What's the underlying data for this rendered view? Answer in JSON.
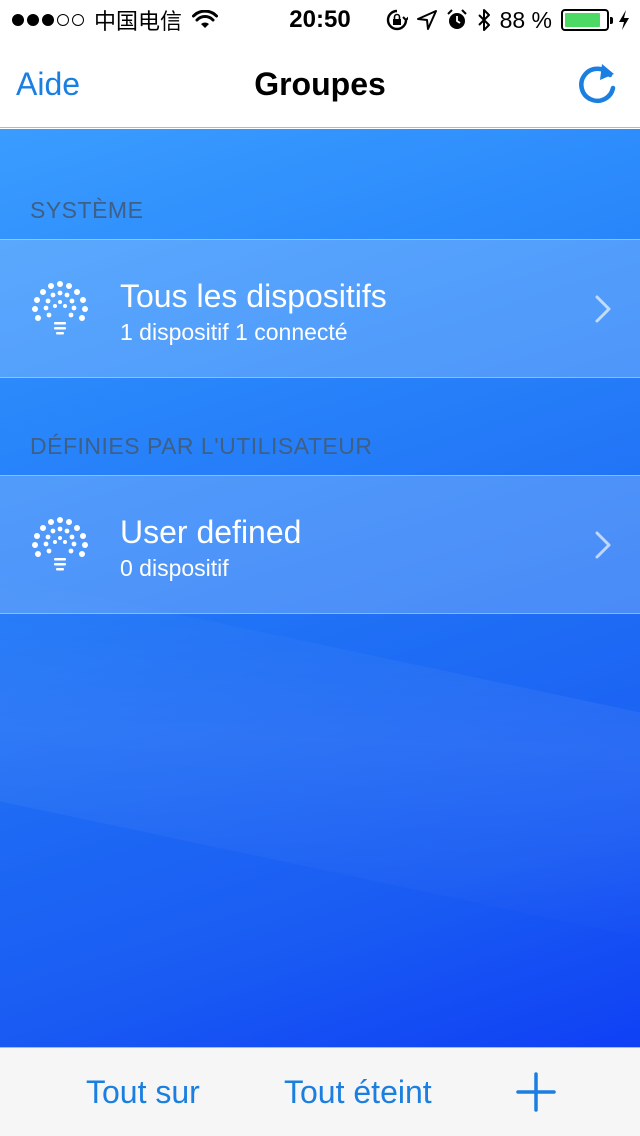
{
  "status_bar": {
    "carrier": "中国电信",
    "time": "20:50",
    "battery_percent": "88 %",
    "battery_level": 0.88,
    "signal_bars_filled": 3,
    "signal_bars_total": 5,
    "icons": [
      "wifi-icon",
      "rotation-lock-icon",
      "location-arrow-icon",
      "alarm-icon",
      "bluetooth-icon",
      "battery-icon",
      "charging-icon"
    ]
  },
  "nav": {
    "left_label": "Aide",
    "title": "Groupes",
    "right_icon": "refresh-icon"
  },
  "sections": [
    {
      "header": "SYSTÈME",
      "rows": [
        {
          "title": "Tous les dispositifs",
          "subtitle": "1 dispositif 1 connecté",
          "icon": "bulb-icon"
        }
      ]
    },
    {
      "header": "DÉFINIES PAR L'UTILISATEUR",
      "rows": [
        {
          "title": "User defined",
          "subtitle": "0 dispositif",
          "icon": "bulb-icon"
        }
      ]
    }
  ],
  "toolbar": {
    "all_on_label": "Tout sur",
    "all_off_label": "Tout éteint",
    "add_icon": "plus-icon"
  },
  "colors": {
    "accent": "#1a7fe0",
    "battery_green": "#4cd964",
    "section_header": "#3e5f86",
    "background_top": "#3a9cff",
    "background_bottom": "#0f40f5"
  }
}
